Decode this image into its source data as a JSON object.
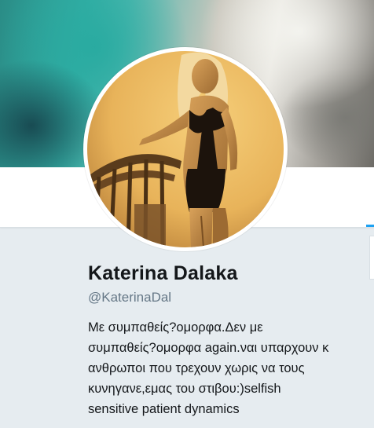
{
  "profile": {
    "name": "Katerina Dalaka",
    "handle": "@KaterinaDal",
    "bio_lines": [
      "Με συμπαθείς?ομορφα.Δεν με",
      "συμπαθείς?ομορφα again.ναι υπαρχουν κ",
      "ανθρωποι που τρεχουν χωρις να τους",
      "κυνηγανε,εμας του στιβου:)selfish",
      "sensitive patient dynamics"
    ]
  },
  "colors": {
    "accent": "#1da1f2",
    "name_text": "#14171a",
    "handle_text": "#657786",
    "page_bg": "#e6ecf0"
  }
}
